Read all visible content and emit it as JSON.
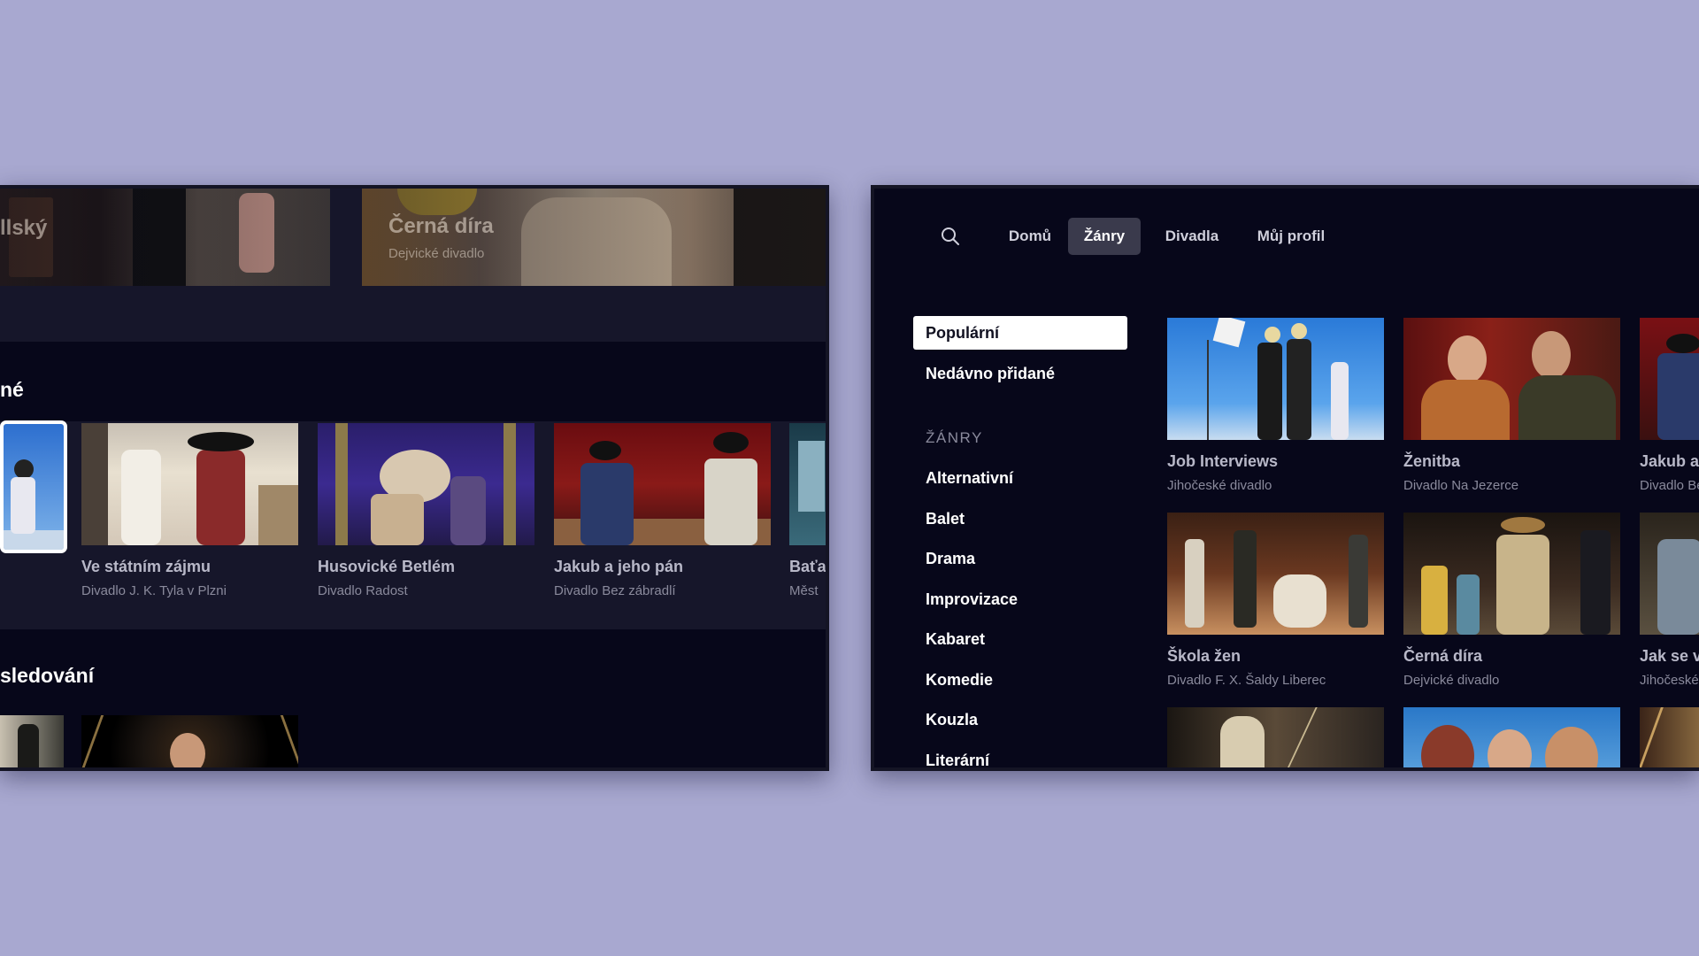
{
  "left": {
    "hero_items": [
      {
        "title": "llský"
      },
      {
        "title": "Černá díra",
        "subtitle": "Dejvické divadlo"
      }
    ],
    "section1_title": "né",
    "section2_title": "sledování",
    "row_items": [
      {
        "title": "Ve státním zájmu",
        "subtitle": "Divadlo J. K. Tyla v Plzni"
      },
      {
        "title": "Husovické Betlém",
        "subtitle": "Divadlo Radost"
      },
      {
        "title": "Jakub a jeho pán",
        "subtitle": "Divadlo Bez zábradlí"
      },
      {
        "title": "Baťa",
        "subtitle": "Měst"
      }
    ]
  },
  "right": {
    "nav": {
      "search_icon": "search-icon",
      "items": [
        {
          "label": "Domů"
        },
        {
          "label": "Žánry"
        },
        {
          "label": "Divadla"
        },
        {
          "label": "Můj profil"
        }
      ],
      "active": "Žánry"
    },
    "sidebar": {
      "popular": "Populární",
      "recent": "Nedávno přidané",
      "genres_heading": "ŽÁNRY",
      "genres": [
        "Alternativní",
        "Balet",
        "Drama",
        "Improvizace",
        "Kabaret",
        "Komedie",
        "Kouzla",
        "Literární"
      ]
    },
    "grid": [
      {
        "title": "Job Interviews",
        "subtitle": "Jihočeské divadlo"
      },
      {
        "title": "Ženitba",
        "subtitle": "Divadlo Na Jezerce"
      },
      {
        "title": "Jakub a",
        "subtitle": "Divadlo Be"
      },
      {
        "title": "Škola žen",
        "subtitle": "Divadlo F. X. Šaldy Liberec"
      },
      {
        "title": "Černá díra",
        "subtitle": "Dejvické divadlo"
      },
      {
        "title": "Jak se v",
        "subtitle": "Jihočeské"
      }
    ]
  },
  "colors": {
    "page_background": "#a8a8d0",
    "screen_background": "#07071a",
    "band_background": "#16162a",
    "active_nav_background": "#3a3a4c",
    "selected_sidebar_background": "#ffffff"
  }
}
